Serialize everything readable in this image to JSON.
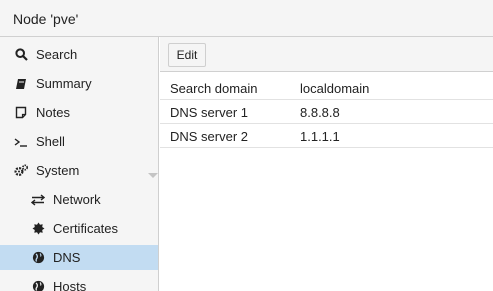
{
  "window": {
    "title": "Node 'pve'"
  },
  "sidebar": {
    "items": [
      {
        "label": "Search",
        "icon": "search-icon"
      },
      {
        "label": "Summary",
        "icon": "book-icon"
      },
      {
        "label": "Notes",
        "icon": "note-icon"
      },
      {
        "label": "Shell",
        "icon": "terminal-icon"
      },
      {
        "label": "System",
        "icon": "gears-icon",
        "expanded": true
      },
      {
        "label": "Network",
        "icon": "exchange-icon",
        "child": true
      },
      {
        "label": "Certificates",
        "icon": "certificate-icon",
        "child": true
      },
      {
        "label": "DNS",
        "icon": "globe-icon",
        "child": true,
        "selected": true
      },
      {
        "label": "Hosts",
        "icon": "globe-icon",
        "child": true
      }
    ]
  },
  "toolbar": {
    "edit_label": "Edit"
  },
  "dns": {
    "rows": [
      {
        "key": "Search domain",
        "value": "localdomain"
      },
      {
        "key": "DNS server 1",
        "value": "8.8.8.8"
      },
      {
        "key": "DNS server 2",
        "value": "1.1.1.1"
      }
    ]
  },
  "colors": {
    "selected_bg": "#c2dcf2",
    "panel_bg": "#f5f5f5",
    "border": "#d0d0d0"
  }
}
